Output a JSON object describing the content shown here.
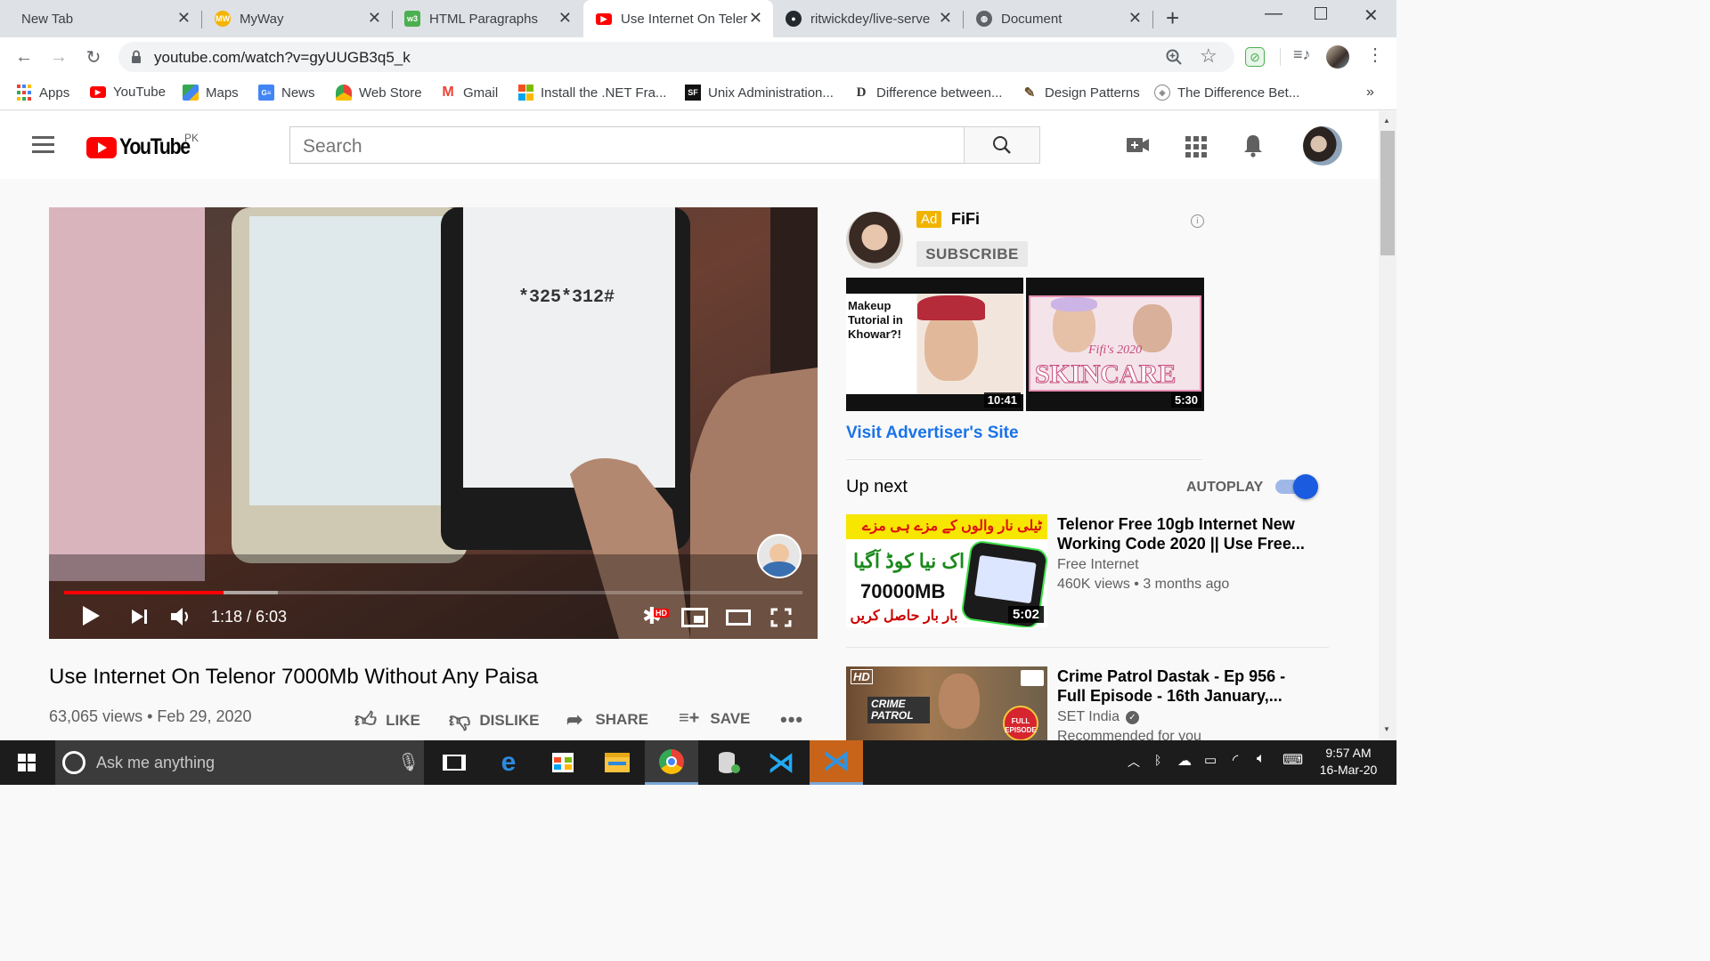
{
  "browser": {
    "tabs": [
      {
        "title": "New Tab",
        "active": false
      },
      {
        "title": "MyWay",
        "active": false
      },
      {
        "title": "HTML Paragraphs",
        "active": false
      },
      {
        "title": "Use Internet On Teler",
        "active": true
      },
      {
        "title": "ritwickdey/live-serve",
        "active": false
      },
      {
        "title": "Document",
        "active": false
      }
    ],
    "url": "youtube.com/watch?v=gyUUGB3q5_k",
    "bookmarks": [
      "Apps",
      "YouTube",
      "Maps",
      "News",
      "Web Store",
      "Gmail",
      "Install the .NET Fra...",
      "Unix Administration...",
      "Difference between...",
      "Design Patterns",
      "The Difference Bet..."
    ]
  },
  "masthead": {
    "logo_text": "YouTube",
    "country": "PK",
    "search_placeholder": "Search"
  },
  "video": {
    "title": "Use Internet On Telenor 7000Mb Without Any Paisa",
    "views": "63,065 views",
    "date": "Feb 29, 2020",
    "time": "1:18 / 6:03",
    "progress": 0.216,
    "buffered": 0.29,
    "quality_badge": "HD",
    "frame_text": "*325*312#",
    "actions": {
      "like": "LIKE",
      "dislike": "DISLIKE",
      "share": "SHARE",
      "save": "SAVE"
    }
  },
  "ad": {
    "badge": "Ad",
    "channel": "FiFi",
    "subscribe": "SUBSCRIBE",
    "thumb1_text": "Makeup Tutorial in Khowar?!",
    "thumb1_duration": "10:41",
    "thumb2_text": "SKINCARE",
    "thumb2_year": "Fifi's 2020",
    "thumb2_duration": "5:30",
    "visit": "Visit Advertiser's Site"
  },
  "upnext": {
    "heading": "Up next",
    "autoplay": "AUTOPLAY",
    "autoplay_on": true,
    "items": [
      {
        "title": "Telenor Free 10gb Internet New Working Code 2020 || Use Free...",
        "channel": "Free Internet",
        "stats": "460K views • 3 months ago",
        "duration": "5:02",
        "thumb_text": "70000MB"
      },
      {
        "title": "Crime Patrol Dastak - Ep 956 - Full Episode - 16th January,...",
        "channel": "SET India",
        "stats": "Recommended for you",
        "thumb_badge": "HD",
        "thumb_text": "CRIME PATROL"
      }
    ]
  },
  "taskbar": {
    "search_placeholder": "Ask me anything",
    "time": "9:57 AM",
    "date": "16-Mar-20"
  }
}
